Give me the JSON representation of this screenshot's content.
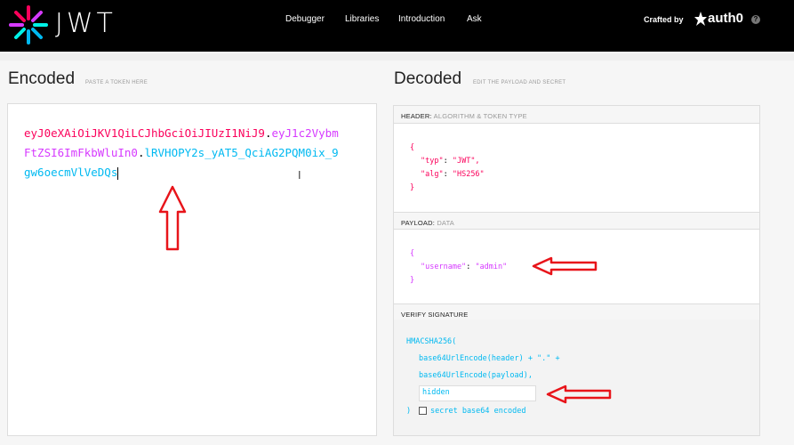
{
  "header": {
    "brand": "JWT",
    "nav": [
      "Debugger",
      "Libraries",
      "Introduction",
      "Ask"
    ],
    "crafted_by": "Crafted by",
    "partner": "auth0",
    "help": "?"
  },
  "encoded": {
    "title": "Encoded",
    "subtitle": "PASTE A TOKEN HERE",
    "token_header": "eyJ0eXAiOiJKV1QiLCJhbGciOiJIUzI1NiJ9",
    "token_payload": "eyJ1c2VybmFtZSI6ImFkbWluIn0",
    "token_signature": "lRVHOPY2s_yAT5_QciAG2PQM0ix_9gw6oecmVlVeDQs",
    "separator": "."
  },
  "decoded": {
    "title": "Decoded",
    "subtitle": "EDIT THE PAYLOAD AND SECRET",
    "header_section": {
      "label": "HEADER:",
      "sublabel": "ALGORITHM & TOKEN TYPE"
    },
    "header_json": {
      "open": "{",
      "typ_key": "\"typ\"",
      "typ_val": "\"JWT\",",
      "alg_key": "\"alg\"",
      "alg_val": "\"HS256\"",
      "close": "}"
    },
    "payload_section": {
      "label": "PAYLOAD:",
      "sublabel": "DATA"
    },
    "payload_json": {
      "open": "{",
      "username_key": "\"username\"",
      "username_val": "\"admin\"",
      "close": "}"
    },
    "signature_section": {
      "label": "VERIFY SIGNATURE"
    },
    "signature": {
      "fn": "HMACSHA256(",
      "line1": "base64UrlEncode(header) + \".\" +",
      "line2": "base64UrlEncode(payload),",
      "secret_value": "hidden",
      "close": ")",
      "checkbox_label": "secret base64 encoded",
      "checkbox_checked": false
    }
  },
  "colors": {
    "header": "#fb015b",
    "payload": "#d63aff",
    "signature": "#00b9f1",
    "arrow": "#e8141a"
  }
}
